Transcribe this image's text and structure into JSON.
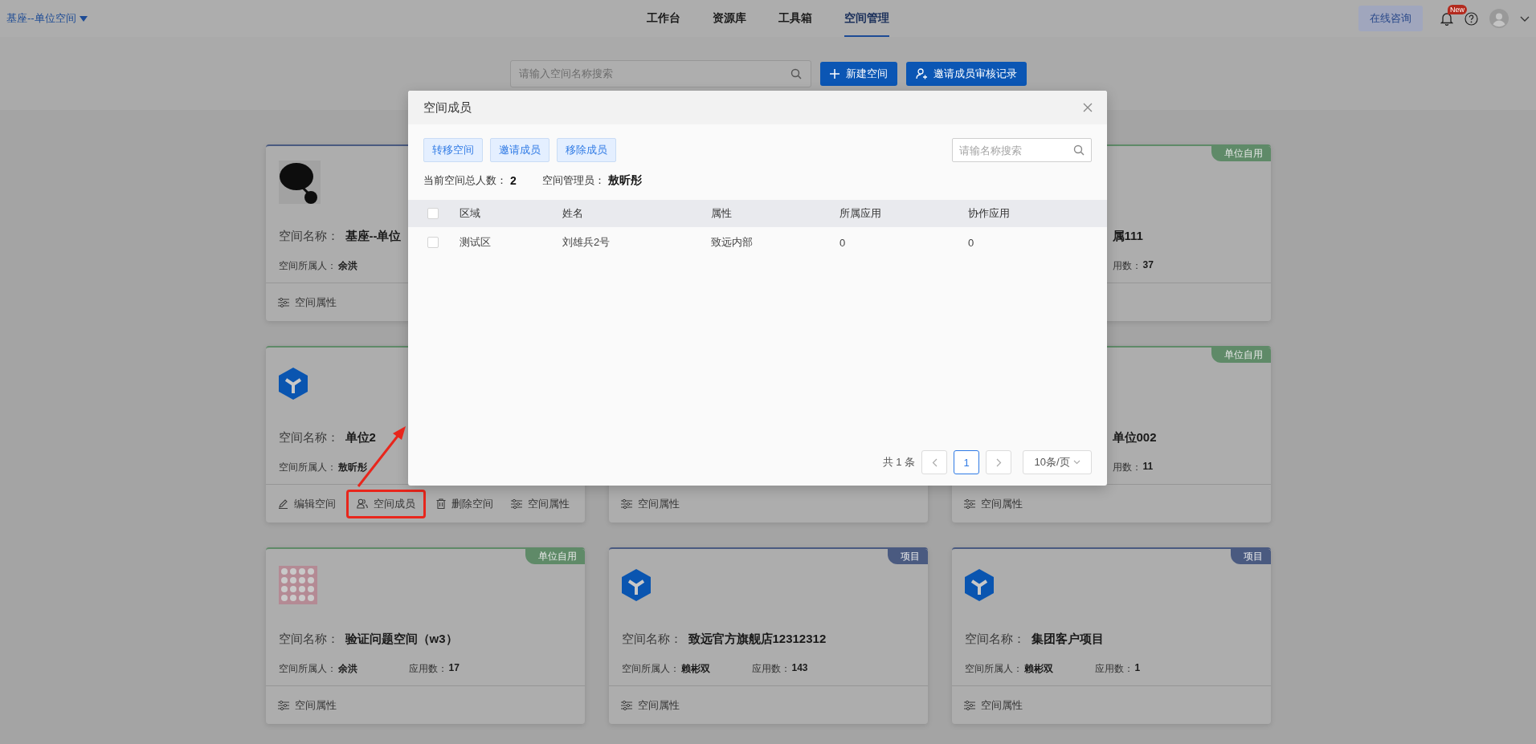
{
  "header": {
    "space_switcher": "基座--单位空间",
    "nav": [
      {
        "label": "工作台",
        "selected": false
      },
      {
        "label": "资源库",
        "selected": false
      },
      {
        "label": "工具箱",
        "selected": false
      },
      {
        "label": "空间管理",
        "selected": true
      }
    ],
    "consult_button": "在线咨询",
    "notification_badge": "New"
  },
  "toolbar": {
    "search": {
      "placeholder": "请输入空间名称搜索"
    },
    "buttons": [
      {
        "label": "新建空间",
        "kind": "add"
      },
      {
        "label": "邀请成员审核记录",
        "kind": "invite"
      }
    ]
  },
  "cards": [
    {
      "kind": "full",
      "color": "#4a5a80",
      "logo": {
        "kind": "dark"
      },
      "name_label": "空间名称：",
      "name": "基座--单位",
      "owner_label": "空间所属人：",
      "owner": "余洪",
      "actions": [
        {
          "label": "空间属性",
          "kind": "properties",
          "highlighted": false
        }
      ]
    },
    {
      "kind": "covered",
      "color": "#5f8a68",
      "tag": "单位自用",
      "name": "属111",
      "apps_label": "用数：",
      "apps": "37"
    },
    {
      "kind": "full",
      "color": "#5f8a68",
      "logo": {
        "kind": "hex"
      },
      "name_label": "空间名称：",
      "name": "单位2",
      "owner_label": "空间所属人：",
      "owner": "敖昕彤",
      "actions": [
        {
          "label": "编辑空间",
          "kind": "edit",
          "highlighted": false
        },
        {
          "label": "空间成员",
          "kind": "members",
          "highlighted": true
        },
        {
          "label": "删除空间",
          "kind": "delete",
          "highlighted": false
        },
        {
          "label": "空间属性",
          "kind": "properties",
          "highlighted": false
        }
      ]
    },
    {
      "kind": "footer_only",
      "actions": [
        {
          "label": "空间属性",
          "kind": "properties",
          "highlighted": false
        }
      ]
    },
    {
      "kind": "covered",
      "color": "#5f8a68",
      "tag": "单位自用",
      "name": "单位002",
      "apps_label": "用数：",
      "apps": "11",
      "actions": [
        {
          "label": "空间属性",
          "kind": "properties",
          "highlighted": false
        }
      ]
    },
    {
      "kind": "full",
      "color": "#5f8a68",
      "tag": "单位自用",
      "logo": {
        "kind": "pink"
      },
      "name_label": "空间名称：",
      "name": "验证问题空间（w3）",
      "owner_label": "空间所属人：",
      "owner": "余洪",
      "apps_label": "应用数：",
      "apps": "17",
      "actions": [
        {
          "label": "空间属性",
          "kind": "properties",
          "highlighted": false
        }
      ]
    },
    {
      "kind": "full",
      "color": "#4a5a80",
      "tag": "项目",
      "logo": {
        "kind": "hex"
      },
      "name_label": "空间名称：",
      "name": "致远官方旗舰店12312312",
      "owner_label": "空间所属人：",
      "owner": "赖彬双",
      "apps_label": "应用数：",
      "apps": "143",
      "actions": [
        {
          "label": "空间属性",
          "kind": "properties",
          "highlighted": false
        }
      ]
    },
    {
      "kind": "full",
      "color": "#4a5a80",
      "tag": "项目",
      "logo": {
        "kind": "hex"
      },
      "name_label": "空间名称：",
      "name": "集团客户项目",
      "owner_label": "空间所属人：",
      "owner": "赖彬双",
      "apps_label": "应用数：",
      "apps": "1",
      "actions": [
        {
          "label": "空间属性",
          "kind": "properties",
          "highlighted": false
        }
      ]
    }
  ],
  "modal": {
    "title": "空间成员",
    "buttons": [
      "转移空间",
      "邀请成员",
      "移除成员"
    ],
    "search": {
      "placeholder": "请输名称搜索"
    },
    "total_label": "当前空间总人数：",
    "total": "2",
    "admin_label": "空间管理员：",
    "admin": "敖昕彤",
    "table": {
      "select_all": {
        "checked": false
      },
      "columns": [
        "区域",
        "姓名",
        "属性",
        "所属应用",
        "协作应用"
      ],
      "rows": [
        {
          "checked": false,
          "cells": [
            "测试区",
            "刘雄兵2号",
            "致远内部",
            "0",
            "0"
          ]
        }
      ]
    },
    "pagination": {
      "total": "共 1 条",
      "pages": [
        {
          "label": "1",
          "selected": true
        }
      ],
      "page_size": "10条/页"
    }
  }
}
